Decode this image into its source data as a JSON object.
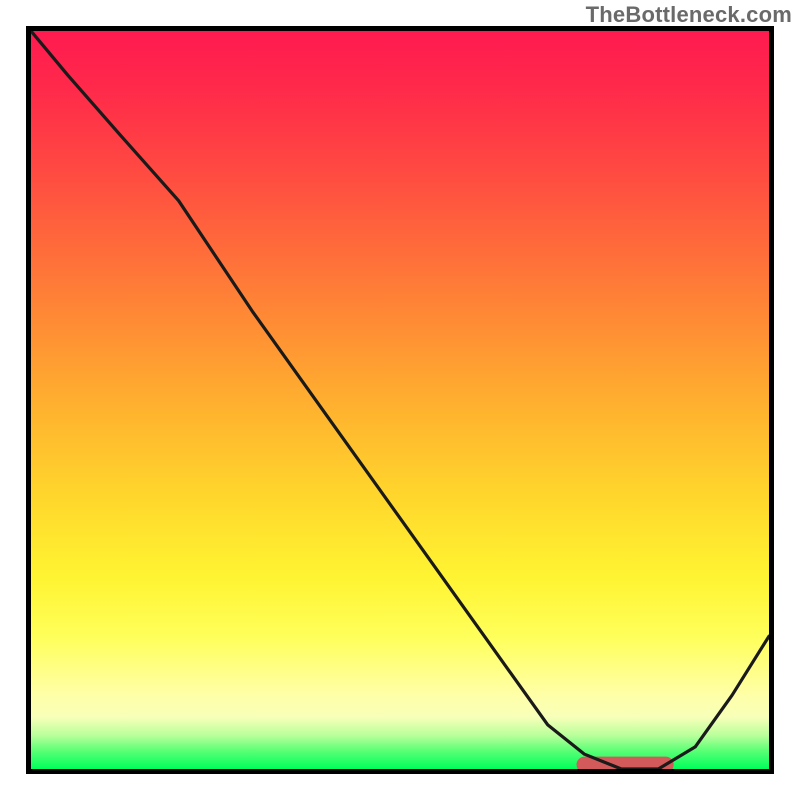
{
  "watermark_text": "TheBottleneck.com",
  "plot_aria_label": "bottleneck curve plot",
  "chart_data": {
    "type": "line",
    "title": "",
    "xlabel": "",
    "ylabel": "",
    "xlim": [
      0,
      100
    ],
    "ylim": [
      0,
      100
    ],
    "grid": false,
    "series": [
      {
        "name": "bottleneck-curve",
        "color": "#1a1a1a",
        "x": [
          0,
          5,
          12,
          20,
          30,
          40,
          50,
          60,
          65,
          70,
          75,
          80,
          85,
          90,
          95,
          100
        ],
        "y": [
          100,
          94,
          86,
          77,
          62,
          48,
          34,
          20,
          13,
          6,
          2,
          0,
          0,
          3,
          10,
          18
        ]
      }
    ],
    "optimal_marker": {
      "color": "#d35a5a",
      "x_start": 75,
      "x_end": 86,
      "y": 0.6
    },
    "background_gradient": {
      "stops": [
        {
          "pos": 0.0,
          "color": "#ff1a50"
        },
        {
          "pos": 0.3,
          "color": "#ff6d3a"
        },
        {
          "pos": 0.55,
          "color": "#ffd000"
        },
        {
          "pos": 0.8,
          "color": "#ffff50"
        },
        {
          "pos": 0.95,
          "color": "#c0ff90"
        },
        {
          "pos": 1.0,
          "color": "#00ff5a"
        }
      ]
    }
  }
}
